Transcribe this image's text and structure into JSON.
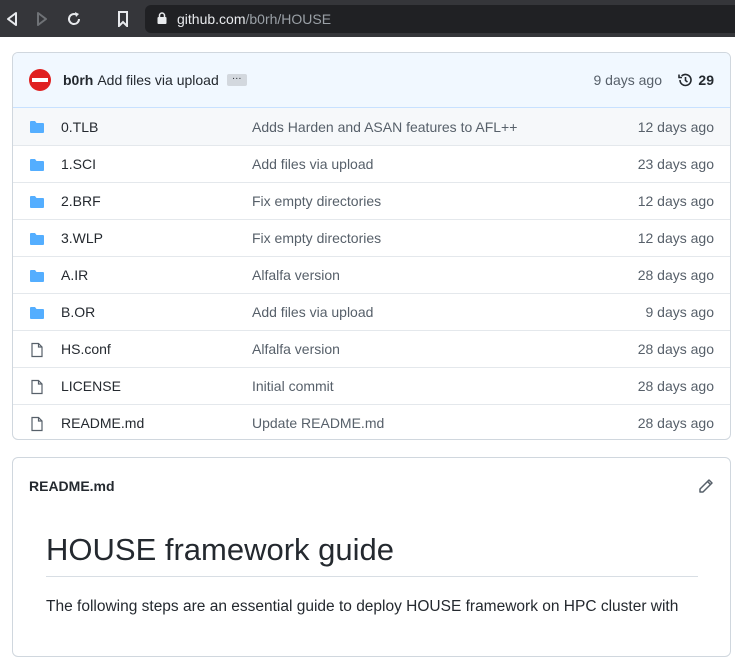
{
  "browser": {
    "url_host": "github.com",
    "url_path": "/b0rh/HOUSE"
  },
  "commit": {
    "author": "b0rh",
    "message": "Add files via upload",
    "ellipsis": "…",
    "time": "9 days ago",
    "history_count": "29"
  },
  "files": [
    {
      "type": "folder",
      "name": "0.TLB",
      "message": "Adds Harden and ASAN features to AFL++",
      "age": "12 days ago"
    },
    {
      "type": "folder",
      "name": "1.SCI",
      "message": "Add files via upload",
      "age": "23 days ago"
    },
    {
      "type": "folder",
      "name": "2.BRF",
      "message": "Fix empty directories",
      "age": "12 days ago"
    },
    {
      "type": "folder",
      "name": "3.WLP",
      "message": "Fix empty directories",
      "age": "12 days ago"
    },
    {
      "type": "folder",
      "name": "A.IR",
      "message": "Alfalfa version",
      "age": "28 days ago"
    },
    {
      "type": "folder",
      "name": "B.OR",
      "message": "Add files via upload",
      "age": "9 days ago"
    },
    {
      "type": "file",
      "name": "HS.conf",
      "message": "Alfalfa version",
      "age": "28 days ago"
    },
    {
      "type": "file",
      "name": "LICENSE",
      "message": "Initial commit",
      "age": "28 days ago"
    },
    {
      "type": "file",
      "name": "README.md",
      "message": "Update README.md",
      "age": "28 days ago"
    }
  ],
  "readme": {
    "filename": "README.md",
    "title": "HOUSE framework guide",
    "intro": "The following steps are an essential guide to deploy HOUSE framework on HPC cluster with"
  },
  "colors": {
    "folder": "#54aeff",
    "accent": "#0969da"
  }
}
